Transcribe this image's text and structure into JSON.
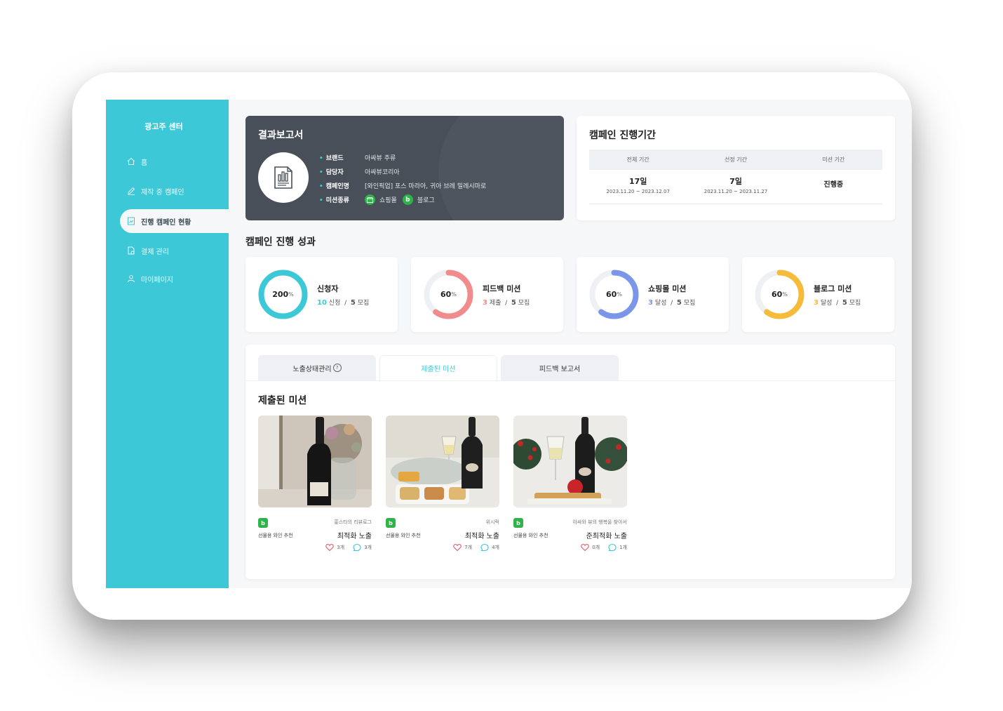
{
  "sidebar": {
    "title": "광고주 센터",
    "items": [
      {
        "label": "홈",
        "icon": "home-icon"
      },
      {
        "label": "제작 중 캠페인",
        "icon": "pencil-icon"
      },
      {
        "label": "진행 캠페인 현황",
        "icon": "report-icon",
        "active": true
      },
      {
        "label": "결제 관리",
        "icon": "payment-doc-icon"
      },
      {
        "label": "마이페이지",
        "icon": "user-icon"
      }
    ]
  },
  "report": {
    "title": "결과보고서",
    "rows": [
      {
        "label": "브랜드",
        "value": "아싸뷰 주류"
      },
      {
        "label": "담당자",
        "value": "아싸뷰코리아"
      },
      {
        "label": "캠페인명",
        "value": "[와인픽업] 포스 마라아, 귀아 브레 밀레시마로"
      },
      {
        "label": "미션종류",
        "chips": [
          {
            "icon": "shop",
            "label": "쇼핑몰"
          },
          {
            "icon": "b",
            "label": "블로그"
          }
        ]
      }
    ]
  },
  "period": {
    "title": "캠페인 진행기간",
    "headers": [
      "전체 기간",
      "선정 기간",
      "미션 기간"
    ],
    "total": {
      "days": "17일",
      "range": "2023.11.20 ~ 2023.12.07"
    },
    "selection": {
      "days": "7일",
      "range": "2023.11.20 ~ 2023.11.27"
    },
    "mission": {
      "status": "진행중"
    }
  },
  "performance": {
    "title": "캠페인 진행 성과",
    "stats": [
      {
        "name": "신청자",
        "percent": "200",
        "unit": "%",
        "count": "10",
        "count_label": "신청",
        "sep": "/",
        "total": "5",
        "total_label": "모집",
        "color": "#3dc8d8",
        "fraction": 1.0
      },
      {
        "name": "피드백 미션",
        "percent": "60",
        "unit": "%",
        "count": "3",
        "count_label": "제출",
        "sep": "/",
        "total": "5",
        "total_label": "모집",
        "color": "#f28b8b",
        "fraction": 0.6
      },
      {
        "name": "쇼핑몰 미션",
        "percent": "60",
        "unit": "%",
        "count": "3",
        "count_label": "달성",
        "sep": "/",
        "total": "5",
        "total_label": "모집",
        "color": "#7b96e8",
        "fraction": 0.6
      },
      {
        "name": "블로그 미션",
        "percent": "60",
        "unit": "%",
        "count": "3",
        "count_label": "달성",
        "sep": "/",
        "total": "5",
        "total_label": "모집",
        "color": "#f6bb3a",
        "fraction": 0.6
      }
    ]
  },
  "tabs": [
    {
      "label": "노출상태관리",
      "help": "?"
    },
    {
      "label": "제출된 미션",
      "active": true
    },
    {
      "label": "피드백 보고서"
    }
  ],
  "missions": {
    "title": "제출된 미션",
    "items": [
      {
        "badge": "b",
        "author": "홍스타의 리뷰로그",
        "category": "선물용 와인 추천",
        "status": "최적화 노출",
        "likes": "3개",
        "comments": "3개"
      },
      {
        "badge": "b",
        "author": "위시럭",
        "category": "선물용 와인 추천",
        "status": "최적화 노출",
        "likes": "7개",
        "comments": "4개"
      },
      {
        "badge": "b",
        "author": "아싸와 뷰의 행복을 찾아서",
        "category": "선물용 와인 추천",
        "status": "준최적화 노출",
        "likes": "0개",
        "comments": "1개"
      }
    ]
  }
}
